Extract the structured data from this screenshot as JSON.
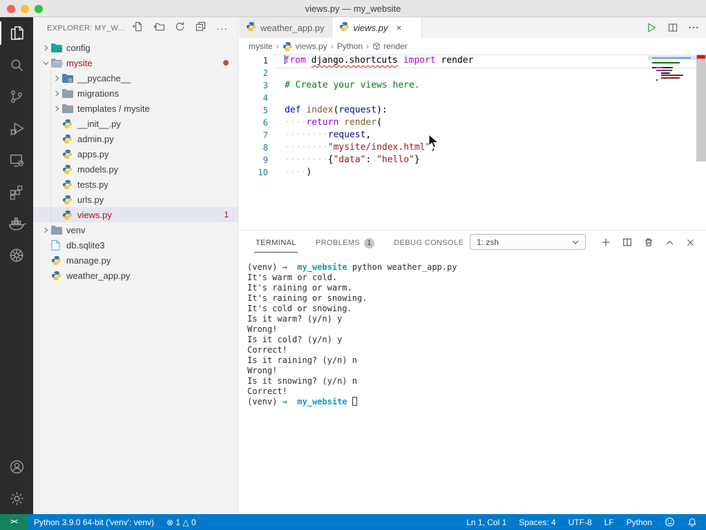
{
  "window": {
    "title": "views.py — my_website"
  },
  "activity_bar": {
    "items": [
      {
        "name": "explorer",
        "active": true
      },
      {
        "name": "search",
        "active": false
      },
      {
        "name": "source-control",
        "active": false
      },
      {
        "name": "run-debug",
        "active": false
      },
      {
        "name": "remote-explorer",
        "active": false
      },
      {
        "name": "extensions",
        "active": false
      },
      {
        "name": "docker",
        "active": false
      },
      {
        "name": "kubernetes",
        "active": false
      }
    ],
    "bottom_items": [
      {
        "name": "account"
      },
      {
        "name": "settings"
      }
    ]
  },
  "sidebar": {
    "title": "EXPLORER: MY_W...",
    "actions": [
      "new-file",
      "new-folder",
      "refresh",
      "collapse-all",
      "more"
    ],
    "tree": [
      {
        "label": "config",
        "depth": 0,
        "chevron": "collapsed",
        "icon": "folder-config"
      },
      {
        "label": "mysite",
        "depth": 0,
        "chevron": "expanded",
        "icon": "folder-open",
        "error": true,
        "badge_dot": true
      },
      {
        "label": "__pycache__",
        "depth": 1,
        "chevron": "collapsed",
        "icon": "folder-python"
      },
      {
        "label": "migrations",
        "depth": 1,
        "chevron": "collapsed",
        "icon": "folder-gray"
      },
      {
        "label": "templates / mysite",
        "depth": 1,
        "chevron": "collapsed",
        "icon": "folder-gray"
      },
      {
        "label": "__init__.py",
        "depth": 1,
        "icon": "python"
      },
      {
        "label": "admin.py",
        "depth": 1,
        "icon": "python"
      },
      {
        "label": "apps.py",
        "depth": 1,
        "icon": "python"
      },
      {
        "label": "models.py",
        "depth": 1,
        "icon": "python"
      },
      {
        "label": "tests.py",
        "depth": 1,
        "icon": "python"
      },
      {
        "label": "urls.py",
        "depth": 1,
        "icon": "python"
      },
      {
        "label": "views.py",
        "depth": 1,
        "icon": "python",
        "error": true,
        "badge": "1",
        "selected": true
      },
      {
        "label": "venv",
        "depth": 0,
        "chevron": "collapsed",
        "icon": "folder-gray"
      },
      {
        "label": "db.sqlite3",
        "depth": 0,
        "icon": "database"
      },
      {
        "label": "manage.py",
        "depth": 0,
        "icon": "python"
      },
      {
        "label": "weather_app.py",
        "depth": 0,
        "icon": "python"
      }
    ]
  },
  "editor": {
    "tabs": [
      {
        "label": "weather_app.py",
        "active": false
      },
      {
        "label": "views.py",
        "active": true,
        "preview": true
      }
    ],
    "breadcrumb": [
      {
        "label": "mysite"
      },
      {
        "label": "views.py",
        "icon": "python"
      },
      {
        "label": "Python"
      },
      {
        "label": "render",
        "icon": "symbol"
      }
    ],
    "code": [
      {
        "n": "1",
        "current": true,
        "tokens": [
          [
            "from",
            "kw"
          ],
          [
            " ",
            ""
          ],
          [
            "django.shortcuts",
            "err"
          ],
          [
            " ",
            ""
          ],
          [
            "import",
            "kw"
          ],
          [
            " render",
            ""
          ]
        ]
      },
      {
        "n": "2",
        "tokens": []
      },
      {
        "n": "3",
        "tokens": [
          [
            "# Create your views here.",
            "com"
          ]
        ]
      },
      {
        "n": "4",
        "tokens": []
      },
      {
        "n": "5",
        "tokens": [
          [
            "def",
            "def"
          ],
          [
            " ",
            ""
          ],
          [
            "index",
            "fn"
          ],
          [
            "(",
            ""
          ],
          [
            "request",
            "param"
          ],
          [
            "):",
            ""
          ]
        ]
      },
      {
        "n": "6",
        "tokens": [
          [
            "····",
            "ws"
          ],
          [
            "return",
            "kw"
          ],
          [
            " ",
            ""
          ],
          [
            "render",
            "fn"
          ],
          [
            "(",
            ""
          ]
        ]
      },
      {
        "n": "7",
        "tokens": [
          [
            "········",
            "ws"
          ],
          [
            "request",
            "param"
          ],
          [
            ",",
            ""
          ]
        ]
      },
      {
        "n": "8",
        "tokens": [
          [
            "········",
            "ws"
          ],
          [
            "\"mysite/index.html\"",
            "str"
          ],
          [
            ",",
            ""
          ]
        ]
      },
      {
        "n": "9",
        "tokens": [
          [
            "········",
            "ws"
          ],
          [
            "{",
            ""
          ],
          [
            "\"data\"",
            "str"
          ],
          [
            ": ",
            ""
          ],
          [
            "\"hello\"",
            "str"
          ],
          [
            "}",
            ""
          ]
        ]
      },
      {
        "n": "10",
        "tokens": [
          [
            "····",
            "ws"
          ],
          [
            ")",
            ""
          ]
        ]
      }
    ]
  },
  "panel": {
    "tabs": [
      {
        "label": "TERMINAL",
        "active": true
      },
      {
        "label": "PROBLEMS",
        "badge": "1"
      },
      {
        "label": "DEBUG CONSOLE"
      }
    ],
    "shell_selector": "1: zsh",
    "terminal": [
      [
        [
          "(venv) ",
          "p"
        ],
        [
          "→",
          "arrow"
        ],
        [
          "  ",
          "p"
        ],
        [
          "my_website",
          "dir"
        ],
        [
          " python weather_app.py",
          "p"
        ]
      ],
      [
        [
          "It's warm or cold.",
          "p"
        ]
      ],
      [
        [
          "It's raining or warm.",
          "p"
        ]
      ],
      [
        [
          "It's raining or snowing.",
          "p"
        ]
      ],
      [
        [
          "It's cold or snowing.",
          "p"
        ]
      ],
      [
        [
          "Is it warm? (y/n) y",
          "p"
        ]
      ],
      [
        [
          "Wrong!",
          "p"
        ]
      ],
      [
        [
          "Is it cold? (y/n) y",
          "p"
        ]
      ],
      [
        [
          "Correct!",
          "p"
        ]
      ],
      [
        [
          "Is it raining? (y/n) n",
          "p"
        ]
      ],
      [
        [
          "Wrong!",
          "p"
        ]
      ],
      [
        [
          "Is it snowing? (y/n) n",
          "p"
        ]
      ],
      [
        [
          "Correct!",
          "p"
        ]
      ],
      [
        [
          "(venv) ",
          "p"
        ],
        [
          "→",
          "arrow"
        ],
        [
          "  ",
          "p"
        ],
        [
          "my_website",
          "dir"
        ],
        [
          " ",
          "p"
        ],
        [
          "",
          "cursor"
        ]
      ]
    ]
  },
  "status_bar": {
    "remote": "><",
    "interpreter": "Python 3.9.0 64-bit ('venv': venv)",
    "problems": "⊗ 1 △ 0",
    "right": [
      "Ln 1, Col 1",
      "Spaces: 4",
      "UTF-8",
      "LF",
      "Python"
    ]
  },
  "colors": {
    "accent": "#007acc",
    "remote_green": "#16825d",
    "error_red": "#b01011"
  }
}
